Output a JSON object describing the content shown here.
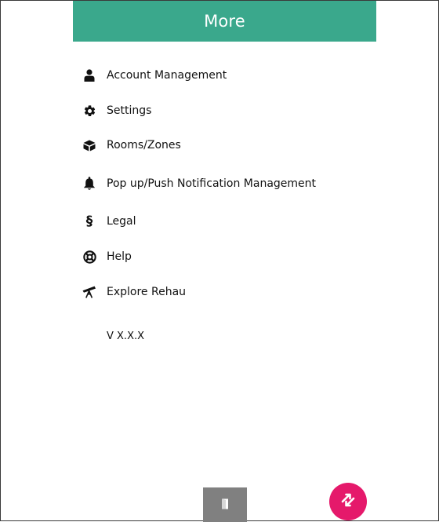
{
  "header": {
    "title": "More"
  },
  "menu": {
    "items": [
      {
        "label": "Account Management",
        "icon": "person-icon"
      },
      {
        "label": "Settings",
        "icon": "gear-icon"
      },
      {
        "label": "Rooms/Zones",
        "icon": "box-icon"
      },
      {
        "label": "Pop up/Push Notification Management",
        "icon": "bell-icon"
      },
      {
        "label": "Legal",
        "icon": "section-sign-icon"
      },
      {
        "label": "Help",
        "icon": "lifebuoy-icon"
      },
      {
        "label": "Explore Rehau",
        "icon": "telescope-icon"
      }
    ]
  },
  "footer": {
    "version": "V X.X.X",
    "door_button_icon": "door-icon",
    "fab_icon": "swap-arrows-icon"
  },
  "colors": {
    "header": "#3aa88c",
    "fab": "#e5196b",
    "door_button": "#808080"
  }
}
